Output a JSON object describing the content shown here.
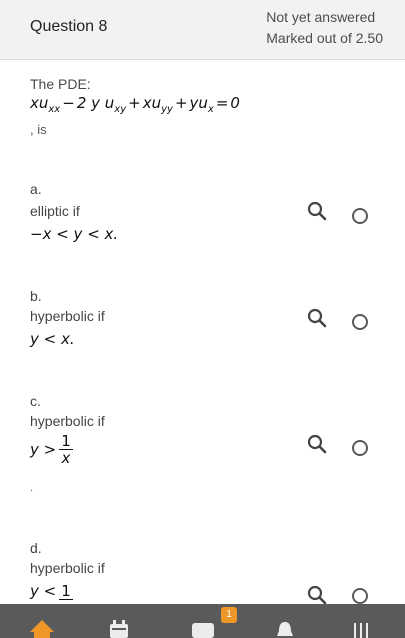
{
  "question": {
    "title": "Question 8",
    "status": "Not yet answered",
    "marks": "Marked out of 2.50"
  },
  "prompt": {
    "lead": "The PDE:",
    "trail": ", is"
  },
  "options": [
    {
      "letter": "a.",
      "label": "elliptic if",
      "math": "−x < y < x."
    },
    {
      "letter": "b.",
      "label": "hyperbolic if",
      "math": "y < x."
    },
    {
      "letter": "c.",
      "label": "hyperbolic if",
      "math_lhs": "y >",
      "frac_num": "1",
      "frac_den": "x",
      "after": "."
    },
    {
      "letter": "d.",
      "label": "hyperbolic if",
      "math_lhs": "y <",
      "frac_num": "1"
    }
  ],
  "bottom_nav": {
    "badge_count": "1"
  },
  "icons": [
    "magnifier-icon",
    "radio-icon",
    "home-icon",
    "calendar-icon",
    "chat-icon",
    "notification-icon",
    "menu-icon"
  ],
  "colors": {
    "header_bg": "#f2f2f2",
    "bottom_bar": "#5a5a5a",
    "badge": "#f0972a",
    "home_icon": "#f0972a"
  }
}
